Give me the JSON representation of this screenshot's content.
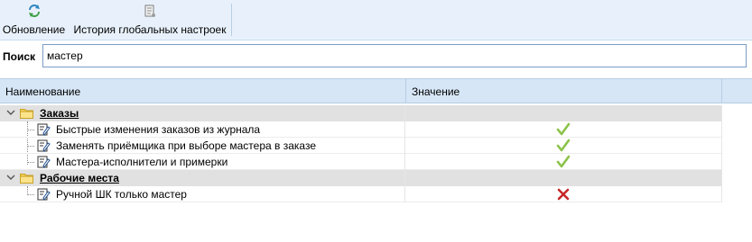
{
  "toolbar": {
    "refresh_label": "Обновление",
    "history_label": "История глобальных настроек"
  },
  "search": {
    "label": "Поиск",
    "value": "мастер"
  },
  "grid": {
    "columns": {
      "name": "Наименование",
      "value": "Значение"
    },
    "groups": [
      {
        "title": "Заказы",
        "items": [
          {
            "name": "Быстрые изменения заказов из журнала",
            "value": "check"
          },
          {
            "name": "Заменять приёмщика при выборе мастера в заказе",
            "value": "check"
          },
          {
            "name": "Мастера-исполнители и примерки",
            "value": "check"
          }
        ]
      },
      {
        "title": "Рабочие места",
        "items": [
          {
            "name": "Ручной ШК только мастер",
            "value": "cross"
          }
        ]
      }
    ]
  },
  "colors": {
    "toolbar_bg": "#e8f1fb",
    "header_bg": "#d6e6f7",
    "group_bg": "#e1e1e1",
    "check": "#8bc34a",
    "cross": "#c62828"
  }
}
